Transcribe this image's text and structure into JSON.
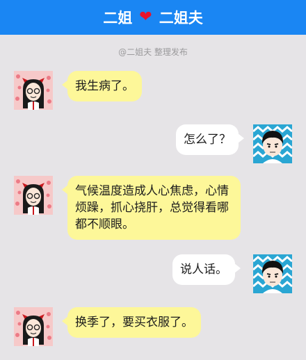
{
  "header": {
    "left_name": "二姐",
    "right_name": "二姐夫",
    "heart_icon": "heart-icon"
  },
  "credit": "@二姐夫 整理发布",
  "colors": {
    "header_bg": "#1a86f3",
    "heart": "#e8122a",
    "left_bubble": "#fdf799",
    "right_bubble": "#ffffff",
    "page_bg": "#e6e4e7"
  },
  "messages": [
    {
      "sender": "二姐",
      "side": "left",
      "text": "我生病了。"
    },
    {
      "sender": "二姐夫",
      "side": "right",
      "text": "怎么了？"
    },
    {
      "sender": "二姐",
      "side": "left",
      "text": "气候温度造成人心焦虑，心情烦躁，抓心挠肝，总觉得看哪都不顺眼。"
    },
    {
      "sender": "二姐夫",
      "side": "right",
      "text": "说人话。"
    },
    {
      "sender": "二姐",
      "side": "left",
      "text": "换季了，要买衣服了。"
    }
  ]
}
